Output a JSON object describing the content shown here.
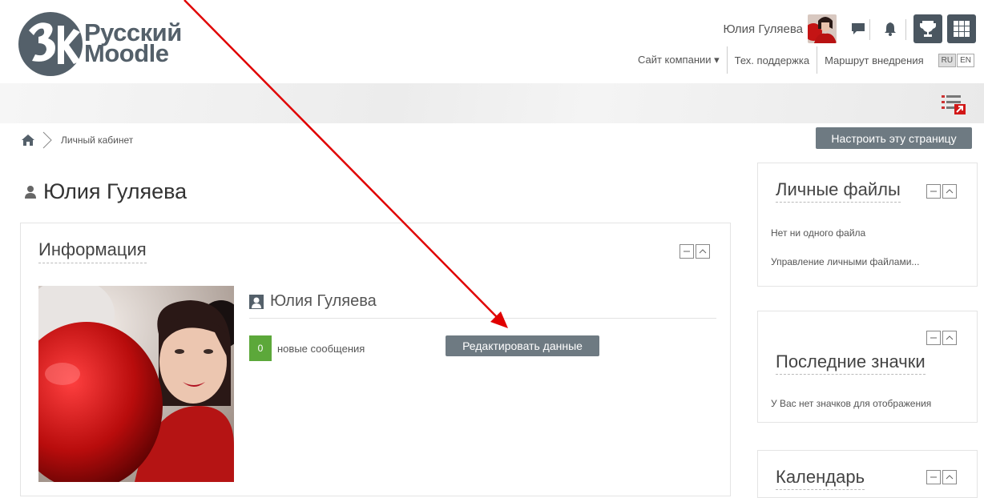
{
  "header": {
    "logo_line1": "Русский",
    "logo_line2": "Moodle",
    "logo_mark_text": "3k",
    "user_name": "Юлия Гуляева",
    "nav_links": [
      "Сайт компании ▾",
      "Тех. поддержка",
      "Маршрут внедрения"
    ],
    "languages": [
      "RU",
      "EN"
    ],
    "active_language": "RU"
  },
  "breadcrumb": {
    "current": "Личный кабинет"
  },
  "customize_button": "Настроить эту страницу",
  "page_title": "Юлия Гуляева",
  "info_block": {
    "title": "Информация",
    "profile_name": "Юлия Гуляева",
    "message_count": "0",
    "messages_label": "новые сообщения",
    "edit_button": "Редактировать данные"
  },
  "sidebar": {
    "files": {
      "title": "Личные файлы",
      "empty_text": "Нет ни одного файла",
      "manage_link": "Управление личными файлами..."
    },
    "badges": {
      "title": "Последние значки",
      "empty_text": "У Вас нет значков для отображения"
    },
    "calendar": {
      "title": "Календарь"
    }
  },
  "colors": {
    "button_bg": "#6e7a82",
    "icon_bg": "#4a5660",
    "badge_green": "#5ca83a",
    "arrow_red": "#e00000"
  }
}
